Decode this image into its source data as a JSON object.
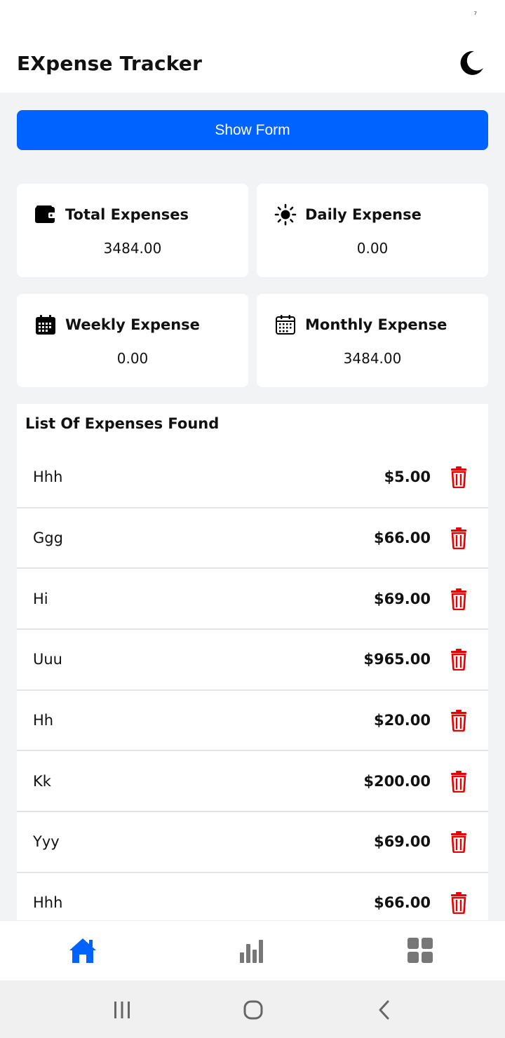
{
  "status_bar": {
    "mark": "⁷"
  },
  "header": {
    "title": "EXpense Tracker",
    "theme_icon": "moon-icon"
  },
  "show_form": {
    "label": "Show Form"
  },
  "summary": [
    {
      "icon": "wallet-icon",
      "title": "Total Expenses",
      "value": "3484.00"
    },
    {
      "icon": "sun-icon",
      "title": "Daily Expense",
      "value": "0.00"
    },
    {
      "icon": "calendar-icon",
      "title": "Weekly Expense",
      "value": "0.00"
    },
    {
      "icon": "calendar-outline-icon",
      "title": "Monthly Expense",
      "value": "3484.00"
    }
  ],
  "list": {
    "title": "List Of Expenses Found",
    "items": [
      {
        "name": "Hhh",
        "amount": "$5.00"
      },
      {
        "name": "Ggg",
        "amount": "$66.00"
      },
      {
        "name": "Hi",
        "amount": "$69.00"
      },
      {
        "name": "Uuu",
        "amount": "$965.00"
      },
      {
        "name": "Hh",
        "amount": "$20.00"
      },
      {
        "name": "Kk",
        "amount": "$200.00"
      },
      {
        "name": "Yyy",
        "amount": "$69.00"
      },
      {
        "name": "Hhh",
        "amount": "$66.00"
      }
    ]
  },
  "bottom_nav": {
    "home_icon": "home-icon",
    "stats_icon": "bar-chart-icon",
    "grid_icon": "grid-icon"
  },
  "colors": {
    "accent": "#0062ff",
    "delete": "#e60000",
    "nav_inactive": "#777777"
  }
}
